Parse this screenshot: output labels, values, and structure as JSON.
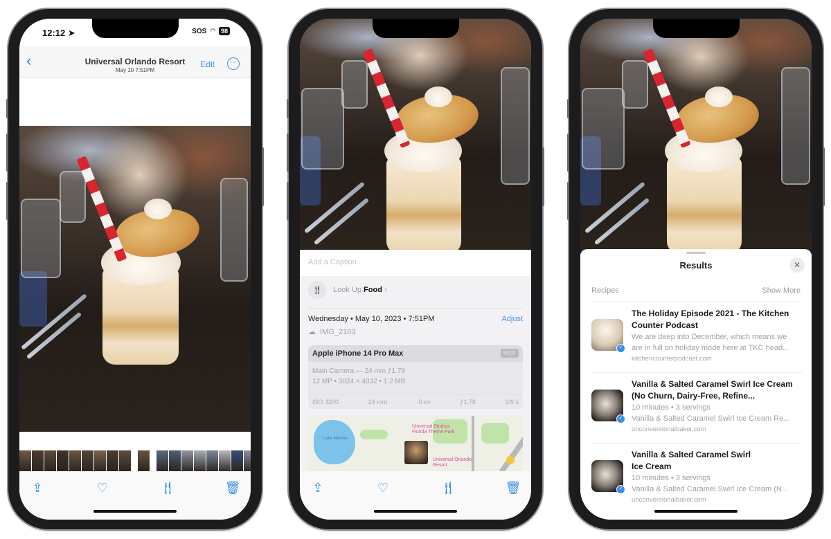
{
  "phone1": {
    "status": {
      "time": "12:12",
      "carrier": "SOS",
      "battery": "98",
      "location_icon": "location-arrow-icon",
      "wifi_icon": "wifi-icon"
    },
    "nav": {
      "back_icon": "chevron-left-icon",
      "title": "Universal Orlando Resort",
      "subtitle": "May 10  7:51PM",
      "edit_label": "Edit",
      "more_icon": "ellipsis-circle-icon"
    },
    "toolbar": {
      "icons": [
        "share-icon",
        "heart-icon",
        "fork-knife-icon",
        "trash-icon"
      ]
    }
  },
  "phone2": {
    "caption_placeholder": "Add a Caption",
    "lookup": {
      "prefix": "Look Up",
      "subject": "Food",
      "chevron": "›",
      "icon": "fork-knife-icon"
    },
    "datetime": "Wednesday • May 10, 2023 • 7:51PM",
    "adjust_label": "Adjust",
    "filename": "IMG_2103",
    "camera": {
      "model": "Apple iPhone 14 Pro Max",
      "format_badge": "HEIF",
      "lens": "Main Camera — 24 mm ƒ1.78",
      "specs": "12 MP • 3024 × 4032 • 1.2 MB",
      "exif": [
        "ISO 3200",
        "24 mm",
        "-0 ev",
        "ƒ1.78",
        "1/9 s"
      ]
    },
    "map": {
      "poi_1": "Universal Studios Florida Theme Park",
      "poi_2": "Universal Orlando Resort",
      "lake_label": "Lake Marsha"
    },
    "toolbar": {
      "icons": [
        "share-icon",
        "heart-icon",
        "fork-knife-icon",
        "trash-icon"
      ]
    }
  },
  "phone3": {
    "sheet_title": "Results",
    "close_label": "✕",
    "section": "Recipes",
    "show_more": "Show More",
    "results": [
      {
        "title": "The Holiday Episode 2021 - The Kitchen Counter Podcast",
        "lines": [
          "We are deep into December, which means we",
          "are in full on holiday mode here at TKC head..."
        ],
        "source": "kitchencounterpodcast.com"
      },
      {
        "title": "Vanilla & Salted Caramel Swirl Ice Cream (No Churn, Dairy-Free, Refine...",
        "lines": [
          "10 minutes • 3 servings",
          "Vanilla & Salted Caramel Swirl Ice Cream Re..."
        ],
        "source": "unconventionalbaker.com"
      },
      {
        "title": "Vanilla & Salted Caramel Swirl Ice Cream",
        "lines": [
          "10 minutes • 3 servings",
          "Vanilla & Salted Caramel Swirl Ice Cream (N..."
        ],
        "source": "unconventionalbaker.com"
      }
    ]
  },
  "colors": {
    "accent": "#3a8ee6",
    "poi": "#e0489c",
    "frame": "#1c1c1e"
  }
}
